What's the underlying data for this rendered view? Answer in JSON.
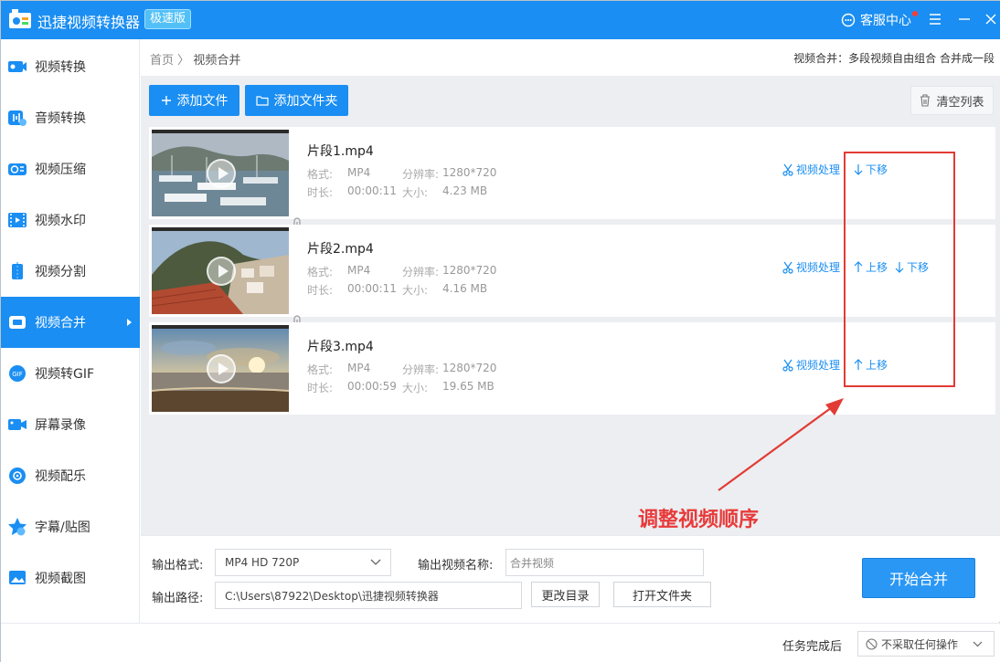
{
  "titlebar": {
    "app_title": "迅捷视频转换器",
    "edition_badge": "极速版",
    "support_label": "客服中心",
    "accent_color": "#1a8ef2"
  },
  "sidebar": {
    "items": [
      {
        "label": "视频转换",
        "icon": "video-convert-icon",
        "active": false
      },
      {
        "label": "音频转换",
        "icon": "audio-convert-icon",
        "active": false
      },
      {
        "label": "视频压缩",
        "icon": "video-compress-icon",
        "active": false
      },
      {
        "label": "视频水印",
        "icon": "video-watermark-icon",
        "active": false
      },
      {
        "label": "视频分割",
        "icon": "video-split-icon",
        "active": false
      },
      {
        "label": "视频合并",
        "icon": "video-merge-icon",
        "active": true
      },
      {
        "label": "视频转GIF",
        "icon": "video-gif-icon",
        "active": false
      },
      {
        "label": "屏幕录像",
        "icon": "screen-record-icon",
        "active": false
      },
      {
        "label": "视频配乐",
        "icon": "video-music-icon",
        "active": false
      },
      {
        "label": "字幕/贴图",
        "icon": "subtitle-sticker-icon",
        "active": false
      },
      {
        "label": "视频截图",
        "icon": "video-screenshot-icon",
        "active": false
      }
    ]
  },
  "breadcrumb": {
    "home": "首页",
    "separator": "〉",
    "current": "视频合并"
  },
  "merge_description": "视频合并：多段视频自由组合 合并成一段",
  "toolbar": {
    "add_file": "添加文件",
    "add_folder": "添加文件夹",
    "clear_list": "清空列表"
  },
  "videos": [
    {
      "name": "片段1.mp4",
      "format_label": "格式:",
      "format": "MP4",
      "resolution_label": "分辨率:",
      "resolution": "1280*720",
      "duration_label": "时长:",
      "duration": "00:00:11",
      "size_label": "大小:",
      "size": "4.23 MB",
      "process": "视频处理",
      "up": "",
      "down": "下移"
    },
    {
      "name": "片段2.mp4",
      "format_label": "格式:",
      "format": "MP4",
      "resolution_label": "分辨率:",
      "resolution": "1280*720",
      "duration_label": "时长:",
      "duration": "00:00:11",
      "size_label": "大小:",
      "size": "4.16 MB",
      "process": "视频处理",
      "up": "上移",
      "down": "下移"
    },
    {
      "name": "片段3.mp4",
      "format_label": "格式:",
      "format": "MP4",
      "resolution_label": "分辨率:",
      "resolution": "1280*720",
      "duration_label": "时长:",
      "duration": "00:00:59",
      "size_label": "大小:",
      "size": "19.65 MB",
      "process": "视频处理",
      "up": "上移",
      "down": ""
    }
  ],
  "annotation": {
    "text": "调整视频顺序",
    "color": "#e83a3a"
  },
  "output": {
    "format_label": "输出格式:",
    "format_value": "MP4   HD 720P",
    "name_label": "输出视频名称:",
    "name_value": "合并视频",
    "path_label": "输出路径:",
    "path_value": "C:\\Users\\87922\\Desktop\\迅捷视频转换器",
    "change_dir": "更改目录",
    "open_folder": "打开文件夹",
    "start_merge": "开始合并"
  },
  "footer": {
    "after_task_label": "任务完成后",
    "after_task_value": "不采取任何操作"
  }
}
